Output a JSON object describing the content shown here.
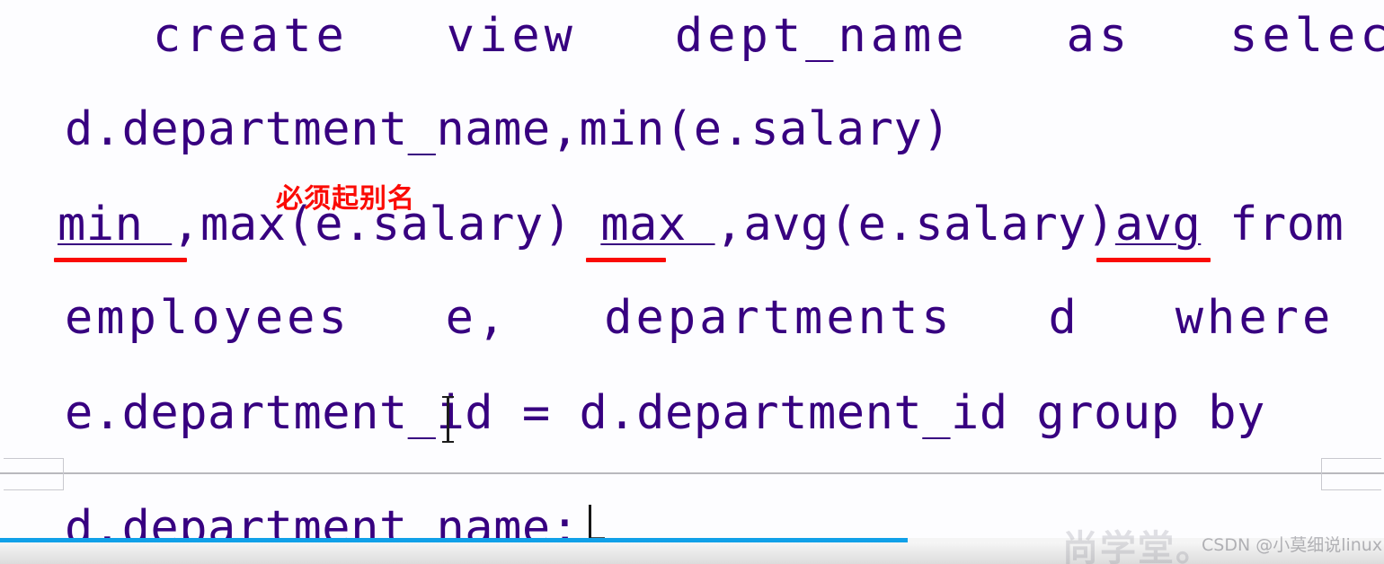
{
  "editor": {
    "lines": [
      {
        "id": "line-1",
        "text": "create   view   dept_name   as   select"
      },
      {
        "id": "line-2",
        "text": "d.department_name,min(e.salary)"
      },
      {
        "id": "line-3a",
        "text": "min ",
        "text_b": ",max(e.salary) ",
        "text_c": "max ",
        "text_d": ",avg(e.salary)",
        "text_e": "avg",
        "text_f": " from"
      },
      {
        "id": "line-4",
        "text": "employees   e,   departments   d   where"
      },
      {
        "id": "line-5",
        "text": "e.department_id = d.department_id group by"
      },
      {
        "id": "line-6",
        "text": "d.department_name;"
      }
    ],
    "text_color": "#370080"
  },
  "annotation": {
    "note_text": "必须起别名",
    "note_color": "#fb0b05",
    "underline_color": "#fa0a05",
    "underlined_terms": [
      "min",
      "max",
      "avg"
    ]
  },
  "page_break": {
    "label": ""
  },
  "cursor": {
    "ibeam_present": true,
    "caret_present": true
  },
  "paste_options": {
    "label": ""
  },
  "player": {
    "progress_color": "#10a0e8",
    "progress_percent": 66
  },
  "watermarks": {
    "brand": "尚学堂。",
    "csdn": "CSDN @小莫细说linux"
  }
}
